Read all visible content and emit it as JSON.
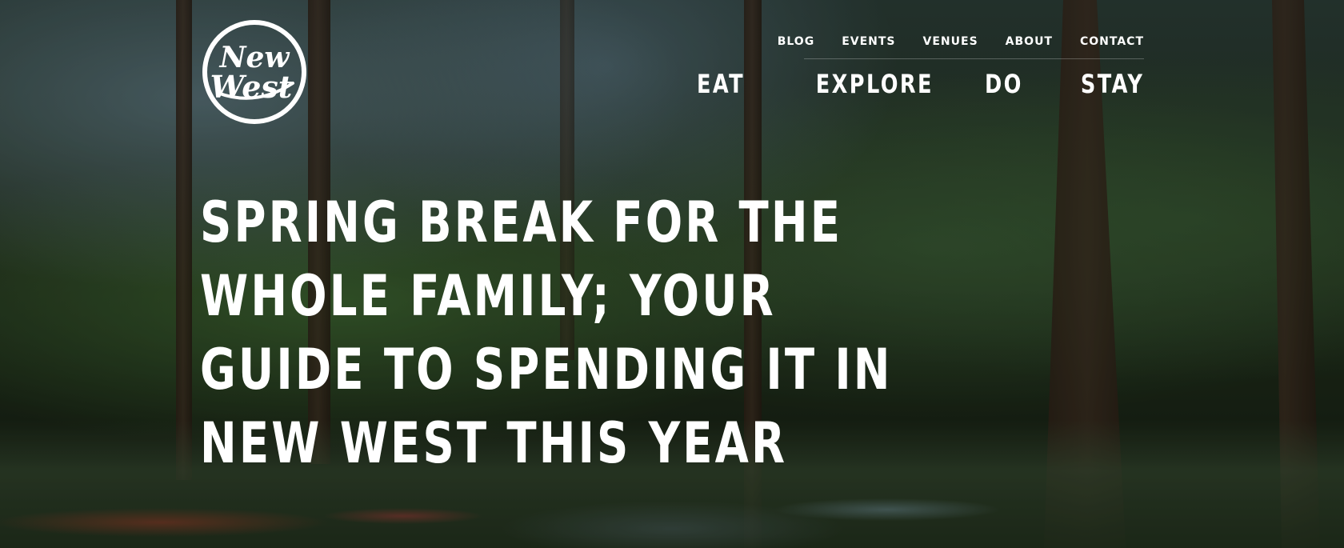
{
  "logo": {
    "line1": "New",
    "line2": "West"
  },
  "top_nav": {
    "items": [
      {
        "label": "BLOG"
      },
      {
        "label": "EVENTS"
      },
      {
        "label": "VENUES"
      },
      {
        "label": "ABOUT"
      },
      {
        "label": "CONTACT"
      }
    ]
  },
  "main_nav": {
    "items": [
      {
        "label": "EAT"
      },
      {
        "label": "EXPLORE"
      },
      {
        "label": "DO"
      },
      {
        "label": "STAY"
      }
    ]
  },
  "hero": {
    "headline": "SPRING BREAK FOR THE WHOLE FAMILY; YOUR GUIDE TO SPENDING IT IN NEW WEST THIS YEAR"
  }
}
